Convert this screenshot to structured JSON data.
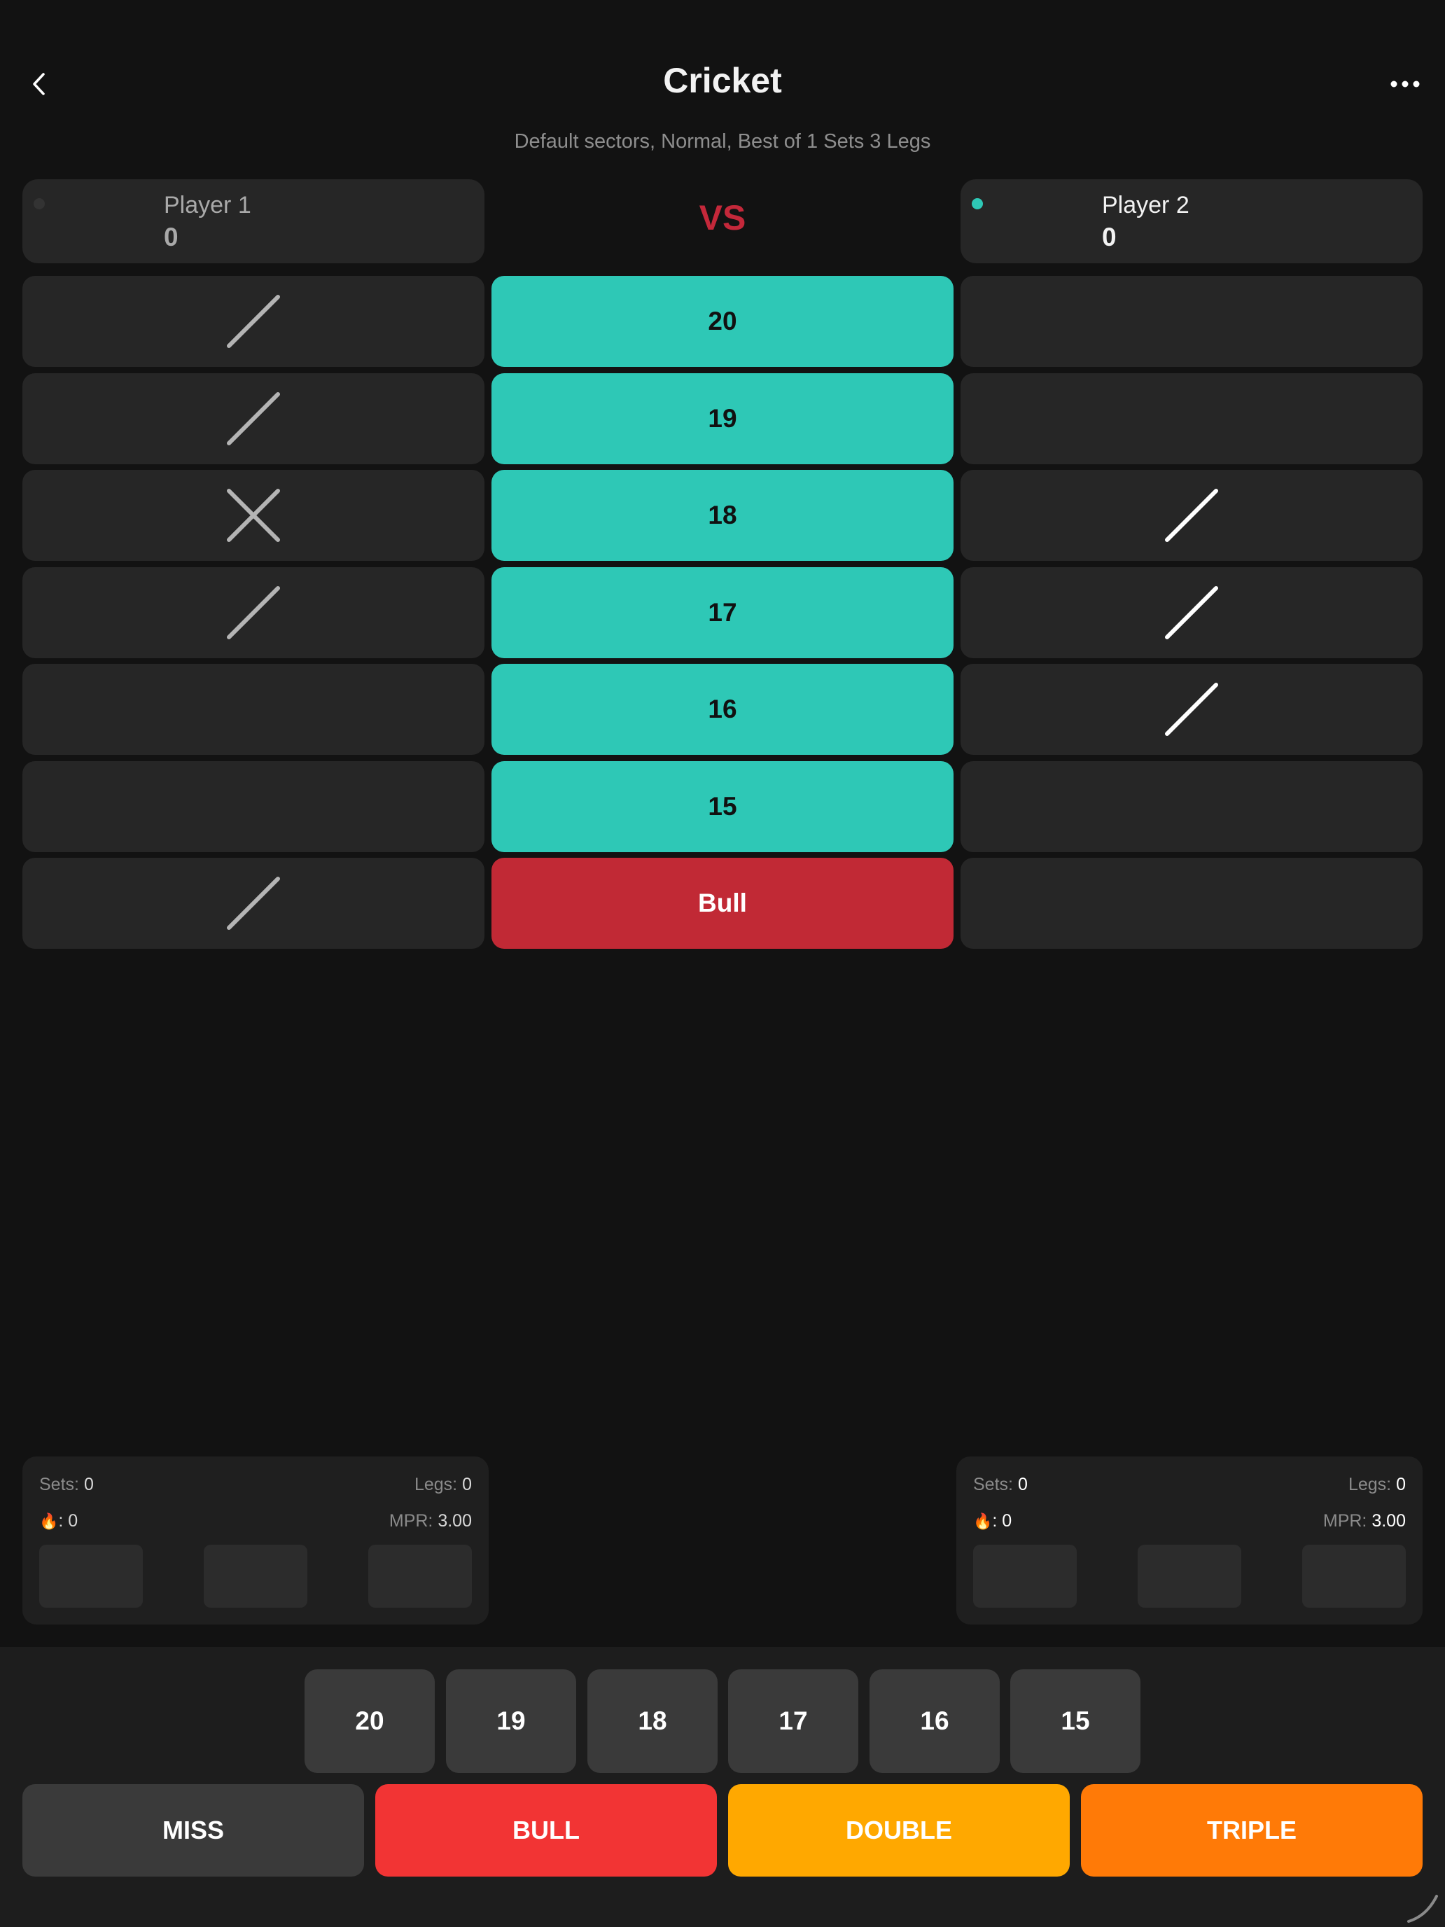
{
  "header": {
    "title": "Cricket",
    "subtitle": "Default sectors, Normal, Best of 1 Sets 3 Legs"
  },
  "players": [
    {
      "name": "Player 1",
      "score": "0",
      "active": false
    },
    {
      "name": "Player 2",
      "score": "0",
      "active": true
    }
  ],
  "vs_label": "VS",
  "sectors": [
    "20",
    "19",
    "18",
    "17",
    "16",
    "15",
    "Bull"
  ],
  "marks": {
    "player1": [
      1,
      1,
      2,
      1,
      0,
      0,
      1
    ],
    "player2": [
      0,
      0,
      1,
      1,
      1,
      0,
      0
    ]
  },
  "stats": [
    {
      "sets_label": "Sets:",
      "sets": "0",
      "legs_label": "Legs:",
      "legs": "0",
      "streak": ": 0",
      "mpr_label": "MPR:",
      "mpr": "3.00"
    },
    {
      "sets_label": "Sets:",
      "sets": "0",
      "legs_label": "Legs:",
      "legs": "0",
      "streak": ": 0",
      "mpr_label": "MPR:",
      "mpr": "3.00"
    }
  ],
  "keypad": {
    "numbers": [
      "20",
      "19",
      "18",
      "17",
      "16",
      "15"
    ],
    "miss": "MISS",
    "bull": "BULL",
    "double": "DOUBLE",
    "triple": "TRIPLE"
  },
  "colors": {
    "accent_teal": "#2ec8b6",
    "bull_red": "#c12935",
    "vs_red": "#c4283a",
    "bull_key": "#f23434",
    "double_key": "#ffa800",
    "triple_key": "#ff7a07",
    "miss_key": "#3a3a3a"
  },
  "icons": {
    "back": "chevron-left-icon",
    "menu": "more-horizontal-icon",
    "streak": "flame-icon"
  }
}
